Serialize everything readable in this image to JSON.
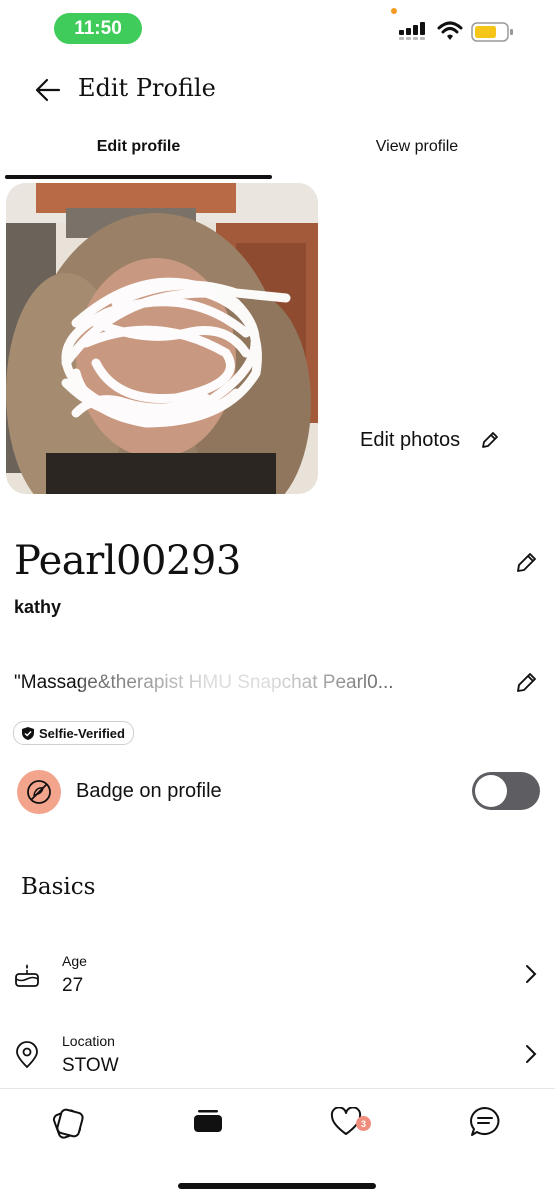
{
  "status_bar": {
    "time": "11:50",
    "time_pill_color": "#3fcc5a",
    "battery_color": "#f5c518"
  },
  "header": {
    "title": "Edit Profile",
    "back_icon": "arrow-left-icon"
  },
  "tabs": [
    {
      "label": "Edit profile",
      "active": true
    },
    {
      "label": "View profile",
      "active": false
    }
  ],
  "photos": {
    "edit_label": "Edit photos",
    "edit_icon": "pencil-icon"
  },
  "profile": {
    "username": "Pearl00293",
    "first_name": "kathy",
    "bio": "\"Massage&therapist HMU Snapchat Pearl0...",
    "verification_label": "Selfie-Verified"
  },
  "badge": {
    "label": "Badge on profile",
    "enabled": false,
    "accent": "#f3a48c"
  },
  "basics": {
    "title": "Basics",
    "items": [
      {
        "label": "Age",
        "value": "27",
        "icon": "birthday-cake-icon"
      },
      {
        "label": "Location",
        "value": "STOW",
        "icon": "location-pin-icon"
      }
    ]
  },
  "bottom_nav": {
    "items": [
      {
        "name": "discover",
        "icon": "cards-icon"
      },
      {
        "name": "standouts",
        "icon": "stack-icon",
        "active": true
      },
      {
        "name": "likes",
        "icon": "heart-icon",
        "badge": "3"
      },
      {
        "name": "messages",
        "icon": "chat-bubble-icon"
      }
    ]
  }
}
